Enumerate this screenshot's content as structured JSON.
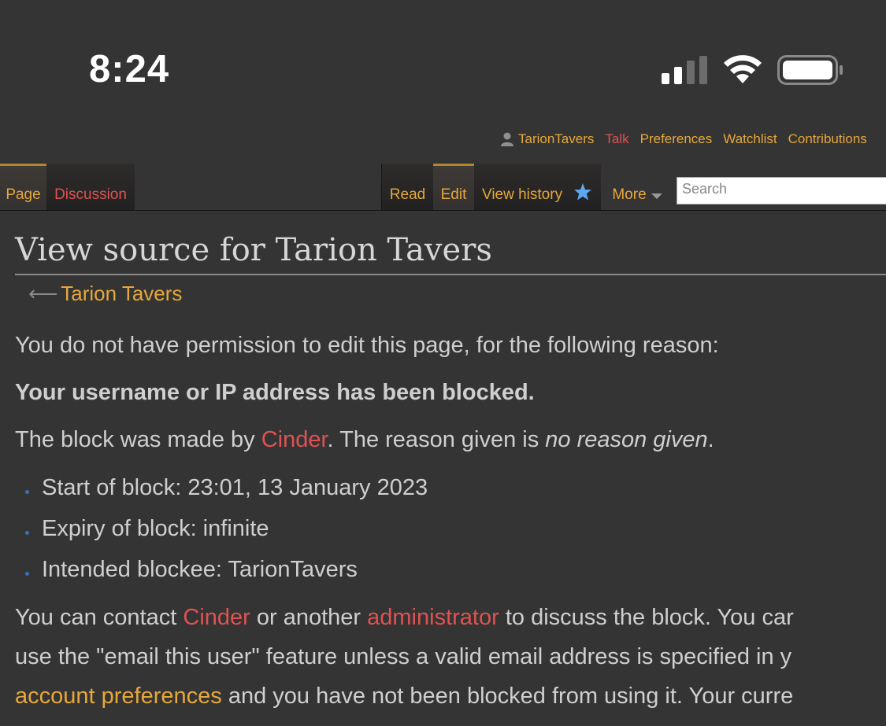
{
  "status_bar": {
    "time": "8:24"
  },
  "personal_tools": {
    "username": "TarionTavers",
    "talk": "Talk",
    "preferences": "Preferences",
    "watchlist": "Watchlist",
    "contributions": "Contributions"
  },
  "tabs": {
    "page": "Page",
    "discussion": "Discussion",
    "read": "Read",
    "edit": "Edit",
    "view_history": "View history",
    "more": "More"
  },
  "search": {
    "placeholder": "Search"
  },
  "content": {
    "title": "View source for Tarion Tavers",
    "back_link": "Tarion Tavers",
    "permission_text": "You do not have permission to edit this page, for the following reason:",
    "blocked_text": "Your username or IP address has been blocked.",
    "block_line": {
      "prefix": "The block was made by ",
      "admin": "Cinder",
      "middle": ". The reason given is ",
      "reason": "no reason given",
      "suffix": "."
    },
    "details": [
      "Start of block: 23:01, 13 January 2023",
      "Expiry of block: infinite",
      "Intended blockee: TarionTavers"
    ],
    "contact": {
      "l1_a": "You can contact ",
      "l1_cinder": "Cinder",
      "l1_b": " or another ",
      "l1_admin": "administrator",
      "l1_c": " to discuss the block. You car",
      "l2": "use the \"email this user\" feature unless a valid email address is specified in y",
      "l3_link": "account preferences",
      "l3_rest": " and you have not been blocked from using it. Your curre"
    }
  },
  "colors": {
    "link_gold": "#e6a83a",
    "link_red": "#e05252",
    "background": "#343434"
  }
}
